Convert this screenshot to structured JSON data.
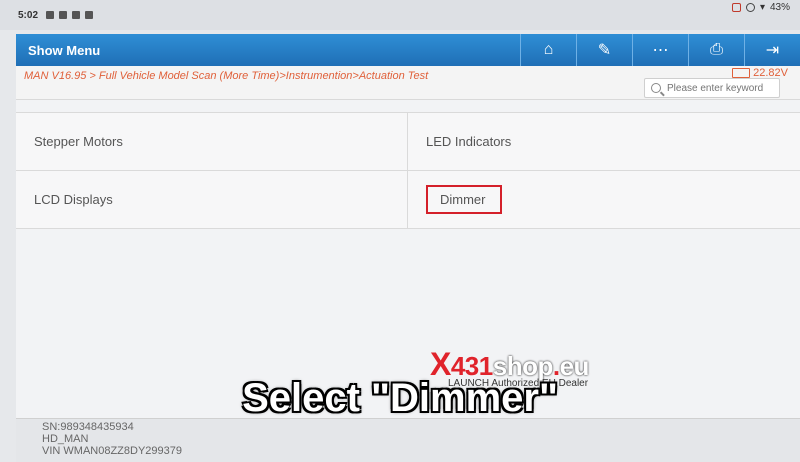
{
  "statusbar": {
    "time": "5:02",
    "battery": "43%"
  },
  "appbar": {
    "title": "Show Menu",
    "tools": [
      {
        "icon": "home-icon",
        "glyph": "⌂"
      },
      {
        "icon": "edit-icon",
        "glyph": "✎"
      },
      {
        "icon": "more-icon",
        "glyph": "⋯"
      },
      {
        "icon": "print-icon",
        "glyph": "⎙"
      },
      {
        "icon": "exit-icon",
        "glyph": "⇥"
      }
    ]
  },
  "breadcrumb": "MAN V16.95 > Full Vehicle Model Scan (More Time)>Instrumention>Actuation Test",
  "voltage": "22.82V",
  "search": {
    "placeholder": "Please enter keyword"
  },
  "menu": {
    "rows": [
      {
        "left": "Stepper Motors",
        "right": "LED Indicators"
      },
      {
        "left": "LCD Displays",
        "right": "Dimmer"
      }
    ]
  },
  "footer": {
    "sn": "SN:989348435934",
    "model": "HD_MAN",
    "vin": "VIN WMAN08ZZ8DY299379"
  },
  "watermark": {
    "x": "X",
    "num": "431",
    "shop": "shop",
    "dot": ".",
    "eu": "eu",
    "sub": "LAUNCH Authorized EU Dealer"
  },
  "caption": "Select \"Dimmer\""
}
